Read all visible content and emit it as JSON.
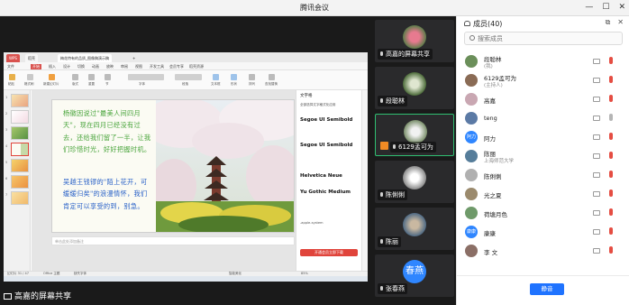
{
  "window": {
    "title": "腾讯会议"
  },
  "share_label": "高嘉的屏幕共享",
  "wps": {
    "tabs": [
      "WPS",
      "稻壳",
      "梅花特有的品质_图像稿演示稿",
      "+"
    ],
    "menu": [
      "文件",
      "开始",
      "插入",
      "设计",
      "切换",
      "动画",
      "放映",
      "审阅",
      "视图",
      "开发工具",
      "会员专享",
      "稻壳资源"
    ],
    "ribbon": [
      "粘贴",
      "格式刷",
      "新建幻灯片",
      "版式",
      "重置",
      "节",
      "字体",
      "段落",
      "文本框",
      "形状",
      "排列",
      "查找替换"
    ],
    "slide_numbers": [
      "1",
      "2",
      "3",
      "4",
      "5",
      "6",
      "7"
    ],
    "poem_top": "杨徽因说过\"最美人间四月天\"，现在四月已经没有过去，还给我们留了一半，让我们珍惜时光，好好把握时机。",
    "poem_bottom": "吴越王钱镠的\"陌上花开，可缓缓归矣\"的浪漫情怀，我们肯定可以享受的到，别急。",
    "notes_placeholder": "单击此处添加备注",
    "side_panel": {
      "title": "文字格",
      "lines": [
        "全部选择文字格式化应用",
        "Segoe UI Semibold",
        "Segoe UI Semibold",
        "Helvetica Neue",
        "Yu Gothic Medium",
        "-apple-system"
      ],
      "button": "开通会员立即下载"
    },
    "status": [
      "幻灯片 31 / 47",
      "Office 主题",
      "缺失字体",
      "智能美化",
      "85%"
    ]
  },
  "tiles": [
    {
      "name": "高嘉的屏幕共享",
      "mic": "gray",
      "active": false
    },
    {
      "name": "段聪林",
      "mic": "gray",
      "active": false
    },
    {
      "name": "6129孟可为",
      "mic": "gray",
      "active": true
    },
    {
      "name": "陈俐俐",
      "mic": "gray",
      "active": false
    },
    {
      "name": "陈丽",
      "mic": "gray",
      "active": false
    },
    {
      "name": "张春燕",
      "mic": "gray",
      "active": false,
      "avatar_text": "春燕"
    }
  ],
  "members": {
    "header": "成员(40)",
    "search_placeholder": "搜索成员",
    "list": [
      {
        "name": "段聪林",
        "sub": "(我)",
        "mic": "red",
        "avatar_color": "#6b8f5a"
      },
      {
        "name": "6129孟可为",
        "sub": "(主持人)",
        "mic": "red",
        "avatar_color": "#8a6b55"
      },
      {
        "name": "高嘉",
        "sub": "",
        "mic": "red",
        "avatar_color": "#c9a7b2"
      },
      {
        "name": "teng",
        "sub": "",
        "mic": "gray",
        "avatar_color": "#5b7aa5"
      },
      {
        "name": "阿力",
        "sub": "",
        "mic": "red",
        "avatar_text": "阿力"
      },
      {
        "name": "陈丽",
        "sub": "上海师范大学",
        "mic": "red",
        "avatar_color": "#567d9a"
      },
      {
        "name": "陈俐俐",
        "sub": "",
        "mic": "red",
        "avatar_color": "#b0b0b0"
      },
      {
        "name": "光之夏",
        "sub": "",
        "mic": "red",
        "avatar_color": "#9b8a6d"
      },
      {
        "name": "荷塘月色",
        "sub": "",
        "mic": "red",
        "avatar_color": "#6f9a6a"
      },
      {
        "name": "康康",
        "sub": "",
        "mic": "red",
        "avatar_text": "康康"
      },
      {
        "name": "李 文",
        "sub": "",
        "mic": "red",
        "avatar_color": "#8b6f66"
      }
    ],
    "mute_all": "静音"
  }
}
